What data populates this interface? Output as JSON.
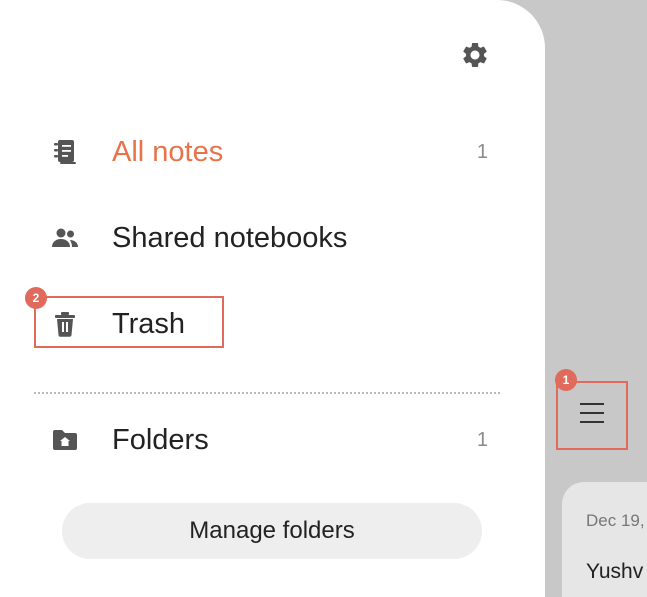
{
  "drawer": {
    "settings_icon": "gear-icon",
    "items": [
      {
        "label": "All notes",
        "count": "1",
        "icon": "notes-icon",
        "active": true
      },
      {
        "label": "Shared notebooks",
        "icon": "people-icon"
      },
      {
        "label": "Trash",
        "icon": "trash-icon"
      }
    ],
    "folders": {
      "label": "Folders",
      "count": "1",
      "icon": "folder-icon"
    },
    "manage_folders_label": "Manage folders"
  },
  "background": {
    "menu_icon": "hamburger-menu-icon",
    "note_date": "Dec 19,",
    "note_title": "Yushv"
  },
  "annotations": [
    {
      "number": "1",
      "target": "hamburger-menu-button"
    },
    {
      "number": "2",
      "target": "trash"
    }
  ],
  "colors": {
    "accent": "#e8734a",
    "annotation": "#e06a5c",
    "drawer_background": "#ffffff",
    "scrim": "#c8c8c8"
  }
}
